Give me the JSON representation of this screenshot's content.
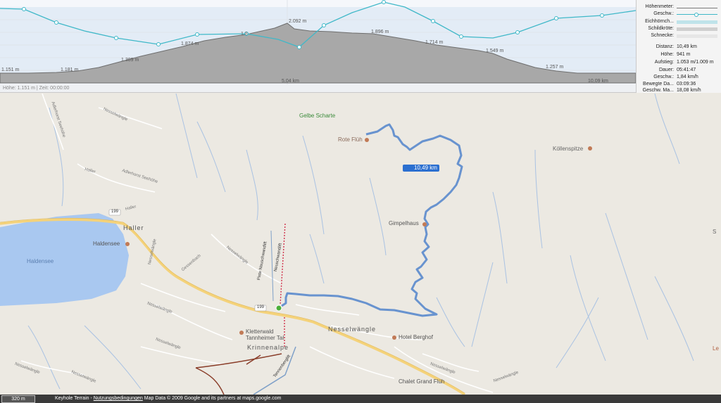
{
  "profile": {
    "elevation_labels": [
      "1.151 m",
      "1.181 m",
      "1.389 m",
      "1.874 m",
      "1.8",
      "2.092 m",
      "1.896 m",
      "1.714 m",
      "1.549 m",
      "1.257 m"
    ],
    "distance_labels": [
      "5,04 km",
      "10,09 km"
    ],
    "cursor_text": "Höhe: 1.151 m | Zeit: 00:00:00"
  },
  "legend": {
    "series": [
      {
        "label": "Höhenmeter:",
        "color": "#7a7a7a"
      },
      {
        "label": "Geschw.:",
        "color": "#3fb8c8"
      },
      {
        "label": "Eichhörnch...",
        "color": "#bfe3ea"
      },
      {
        "label": "Schildkröte:",
        "color": "#cfcfcf"
      },
      {
        "label": "Schnecke:",
        "color": "#e6e6e6"
      }
    ],
    "stats": [
      {
        "label": "Distanz:",
        "value": "10,49 km"
      },
      {
        "label": "Höhe:",
        "value": "941 m"
      },
      {
        "label": "Aufstieg:",
        "value": "1.053 m/1.009 m"
      },
      {
        "label": "Dauer:",
        "value": "05:41:47"
      },
      {
        "label": "Geschw.:",
        "value": "1,84 km/h"
      },
      {
        "label": "Bewegte Da...",
        "value": "03:09:36"
      },
      {
        "label": "Geschw. Ma...",
        "value": "18,08 km/h"
      }
    ]
  },
  "map": {
    "labels": {
      "gelbe_scharte": "Gelbe Scharte",
      "rote_fluh": "Rote Flüh",
      "koellenspitze": "Köllenspitze",
      "gimpelhaus": "Gimpelhaus",
      "haller": "Haller",
      "haldensee_poi": "Haldensee",
      "haldensee_lake": "Haldensee",
      "adlerhorst_1": "Adlerhorst Seehöhe",
      "adlerhorst_2": "Adlerhorst Seehöhe",
      "haller_road": "Haller",
      "haller_road2": "Haller",
      "gessenbach": "Gessenbach",
      "nesselwaengle_main": "Nesselwängle",
      "nesselwaengle_road1": "Nesselwängle",
      "nesselwaengle_road2": "Nesselwängle",
      "nesselwaengle_road3": "Nesselwängle",
      "nesselwaengle_road4": "Nesselwängle",
      "nesselwaengle_road5": "Nesselwängle",
      "nesselwaengle_road6": "Nesselwängle",
      "nesselwaengle_road7": "Nesselwängle",
      "nesselwaengle_road8": "Nesselwängle",
      "nesselwaengle_road9": "Nesselwängle",
      "kletterwald_1": "Kletterwald",
      "kletterwald_2": "Tannheimer Tal",
      "krinnenalpe": "Krinnenalpe",
      "hotel_berghof": "Hotel Berghof",
      "chalet": "Chalet Grand Flüh",
      "piste": "Piste Neuschwandlift",
      "neuschwandlift": "Neuschwandlift",
      "tennenberglift": "Tennenberglift",
      "route_199_a": "199",
      "route_199_b": "199",
      "distance_badge": "10,49 km",
      "edge_s": "S",
      "edge_le": "Le"
    }
  },
  "bottom": {
    "scale": "320 m",
    "layer": "Keyhole Terrain",
    "sep": " - ",
    "terms_link": "Nutzungsbedingungen",
    "credit": " Map Data © 2009 Google and its partners at maps.google.com"
  }
}
